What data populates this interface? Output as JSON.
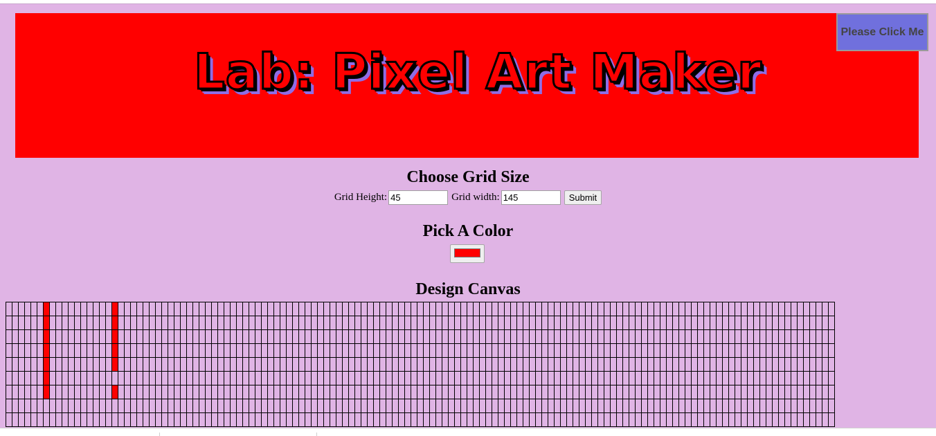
{
  "banner": {
    "title": "Lab: Pixel Art Maker",
    "background_color": "#ff0000",
    "title_shadow_color": "#8f6de6"
  },
  "click_button": {
    "label": "Please Click Me",
    "background_color": "#7070dd"
  },
  "grid_size": {
    "heading": "Choose Grid Size",
    "height_label": "Grid Height:",
    "height_value": "45",
    "width_label": "Grid width:",
    "width_value": "145",
    "submit_label": "Submit"
  },
  "color_section": {
    "heading": "Pick A Color",
    "selected_color": "#ff0000"
  },
  "canvas": {
    "heading": "Design Canvas",
    "visible_rows": 9,
    "visible_cols": 133,
    "grid_line_color": "#000000",
    "cell_background": "#e0b4e5",
    "painted_color": "#ff0000",
    "painted_cells": [
      [
        0,
        6
      ],
      [
        1,
        6
      ],
      [
        2,
        6
      ],
      [
        3,
        6
      ],
      [
        4,
        6
      ],
      [
        5,
        6
      ],
      [
        6,
        6
      ],
      [
        0,
        17
      ],
      [
        1,
        17
      ],
      [
        2,
        17
      ],
      [
        3,
        17
      ],
      [
        4,
        17
      ],
      [
        6,
        17
      ]
    ]
  },
  "page": {
    "background_color": "#e0b4e5"
  }
}
